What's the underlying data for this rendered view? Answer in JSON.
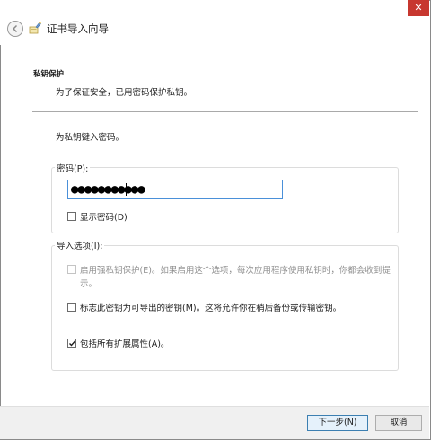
{
  "window": {
    "title": "证书导入向导",
    "close_symbol": "✕"
  },
  "header": {
    "heading": "私钥保护",
    "description": "为了保证安全，已用密码保护私钥。"
  },
  "instruction": "为私钥键入密码。",
  "password_group": {
    "label": "密码(P):",
    "input_value": "●●●●●●●●●●●",
    "show_password_label": "显示密码(D)",
    "show_password_checked": false
  },
  "import_options": {
    "label": "导入选项(I):",
    "strong_protection_line1": "启用强私钥保护(E)。如果启用这个选项，每次应用程序使用私钥时，你都会收到提",
    "strong_protection_line2": "示。",
    "strong_protection_enabled": false,
    "exportable_label": "标志此密钥为可导出的密钥(M)。这将允许你在稍后备份或传输密钥。",
    "exportable_checked": false,
    "include_extended_label": "包括所有扩展属性(A)。",
    "include_extended_checked": true
  },
  "footer": {
    "next_label": "下一步(N)",
    "cancel_label": "取消"
  },
  "colors": {
    "accent": "#4a90d9",
    "close": "#c7372f"
  }
}
